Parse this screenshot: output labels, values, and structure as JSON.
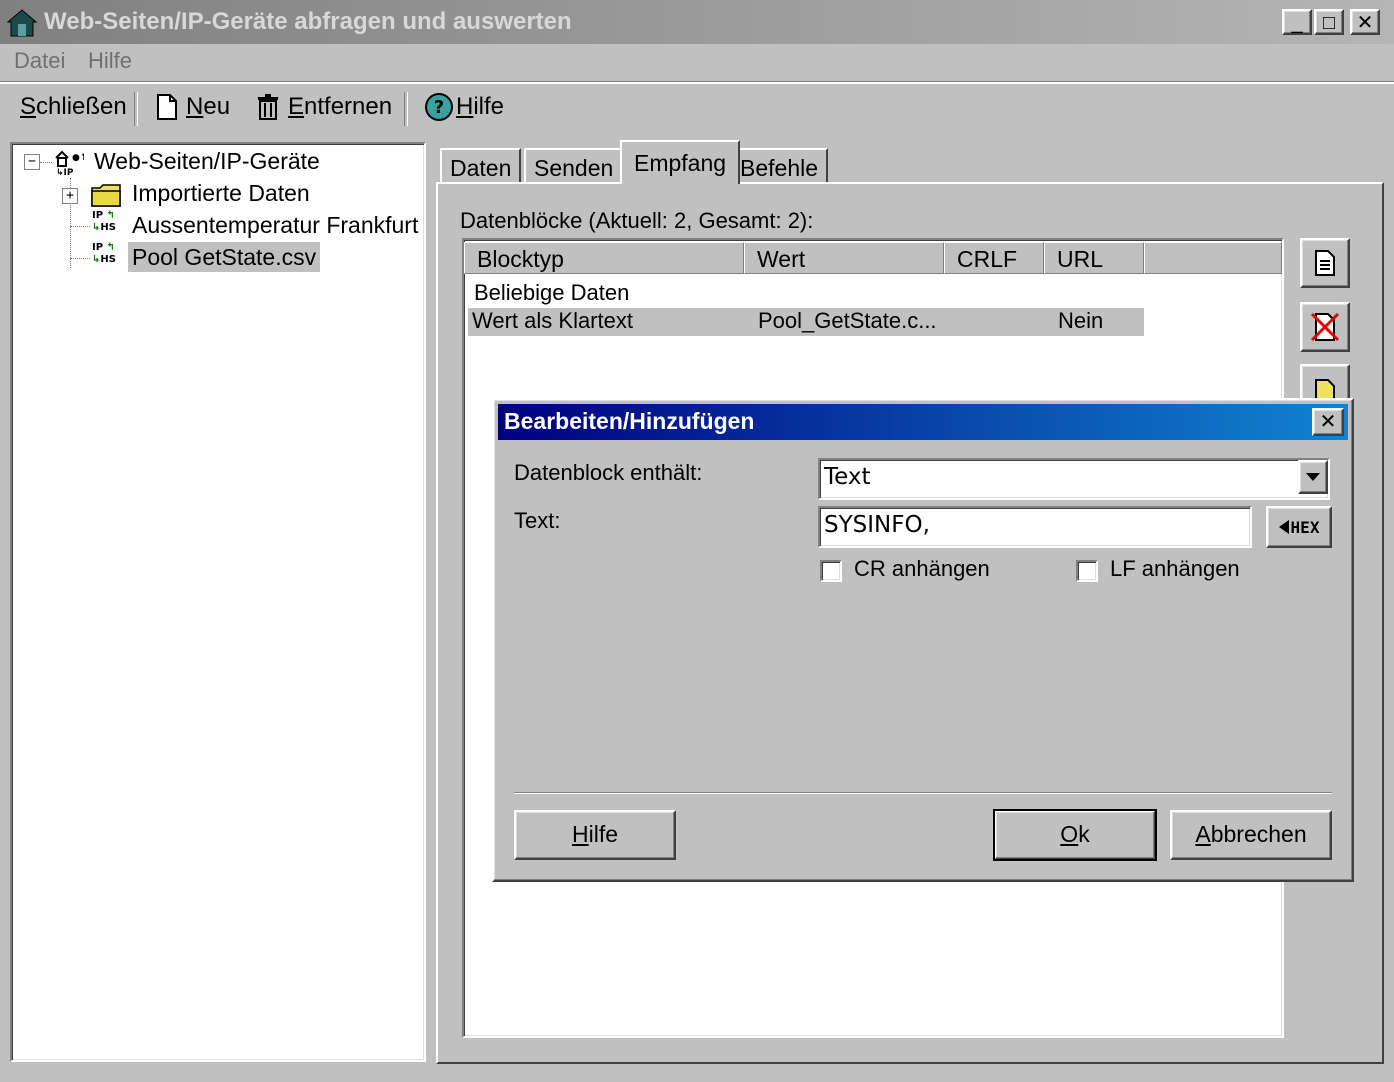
{
  "window": {
    "title": "Web-Seiten/IP-Geräte abfragen und auswerten",
    "min_glyph": "_",
    "max_glyph": "□",
    "close_glyph": "✕"
  },
  "menu": {
    "items": [
      "Datei",
      "Hilfe"
    ]
  },
  "toolbar": {
    "close_label_pre": "",
    "close_label_ul": "S",
    "close_label_post": "chließen",
    "new_ul": "N",
    "new_post": "eu",
    "remove_ul": "E",
    "remove_post": "ntfernen",
    "help_ul": "H",
    "help_post": "ilfe"
  },
  "tree": {
    "root": "Web-Seiten/IP-Geräte",
    "items": [
      "Importierte Daten",
      "Aussentemperatur Frankfurt",
      "Pool GetState.csv"
    ],
    "root_expander": "−",
    "folder_expander": "+",
    "device_badge_top": "IP",
    "device_badge_bottom": "HS"
  },
  "tabs": [
    "Daten",
    "Senden",
    "Empfang",
    "Befehle"
  ],
  "active_tab": "Empfang",
  "panel": {
    "caption": "Datenblöcke (Aktuell: 2, Gesamt: 2):",
    "columns": [
      "Blocktyp",
      "Wert",
      "CRLF",
      "URL"
    ],
    "rows": [
      {
        "blocktyp": "Beliebige Daten",
        "wert": "",
        "crlf": "",
        "url": ""
      },
      {
        "blocktyp": "Wert als Klartext",
        "wert": "Pool_GetState.c...",
        "crlf": "",
        "url": "Nein"
      }
    ]
  },
  "dialog": {
    "title": "Bearbeiten/Hinzufügen",
    "close_glyph": "✕",
    "label_content": "Datenblock enthält:",
    "content_value": "Text",
    "label_text": "Text:",
    "text_value": "SYSINFO,",
    "hex_label": "HEX",
    "cr_label": "CR anhängen",
    "lf_label": "LF anhängen",
    "help_ul": "H",
    "help_post": "ilfe",
    "ok_ul": "O",
    "ok_post": "k",
    "cancel_ul": "A",
    "cancel_post": "bbrechen"
  }
}
